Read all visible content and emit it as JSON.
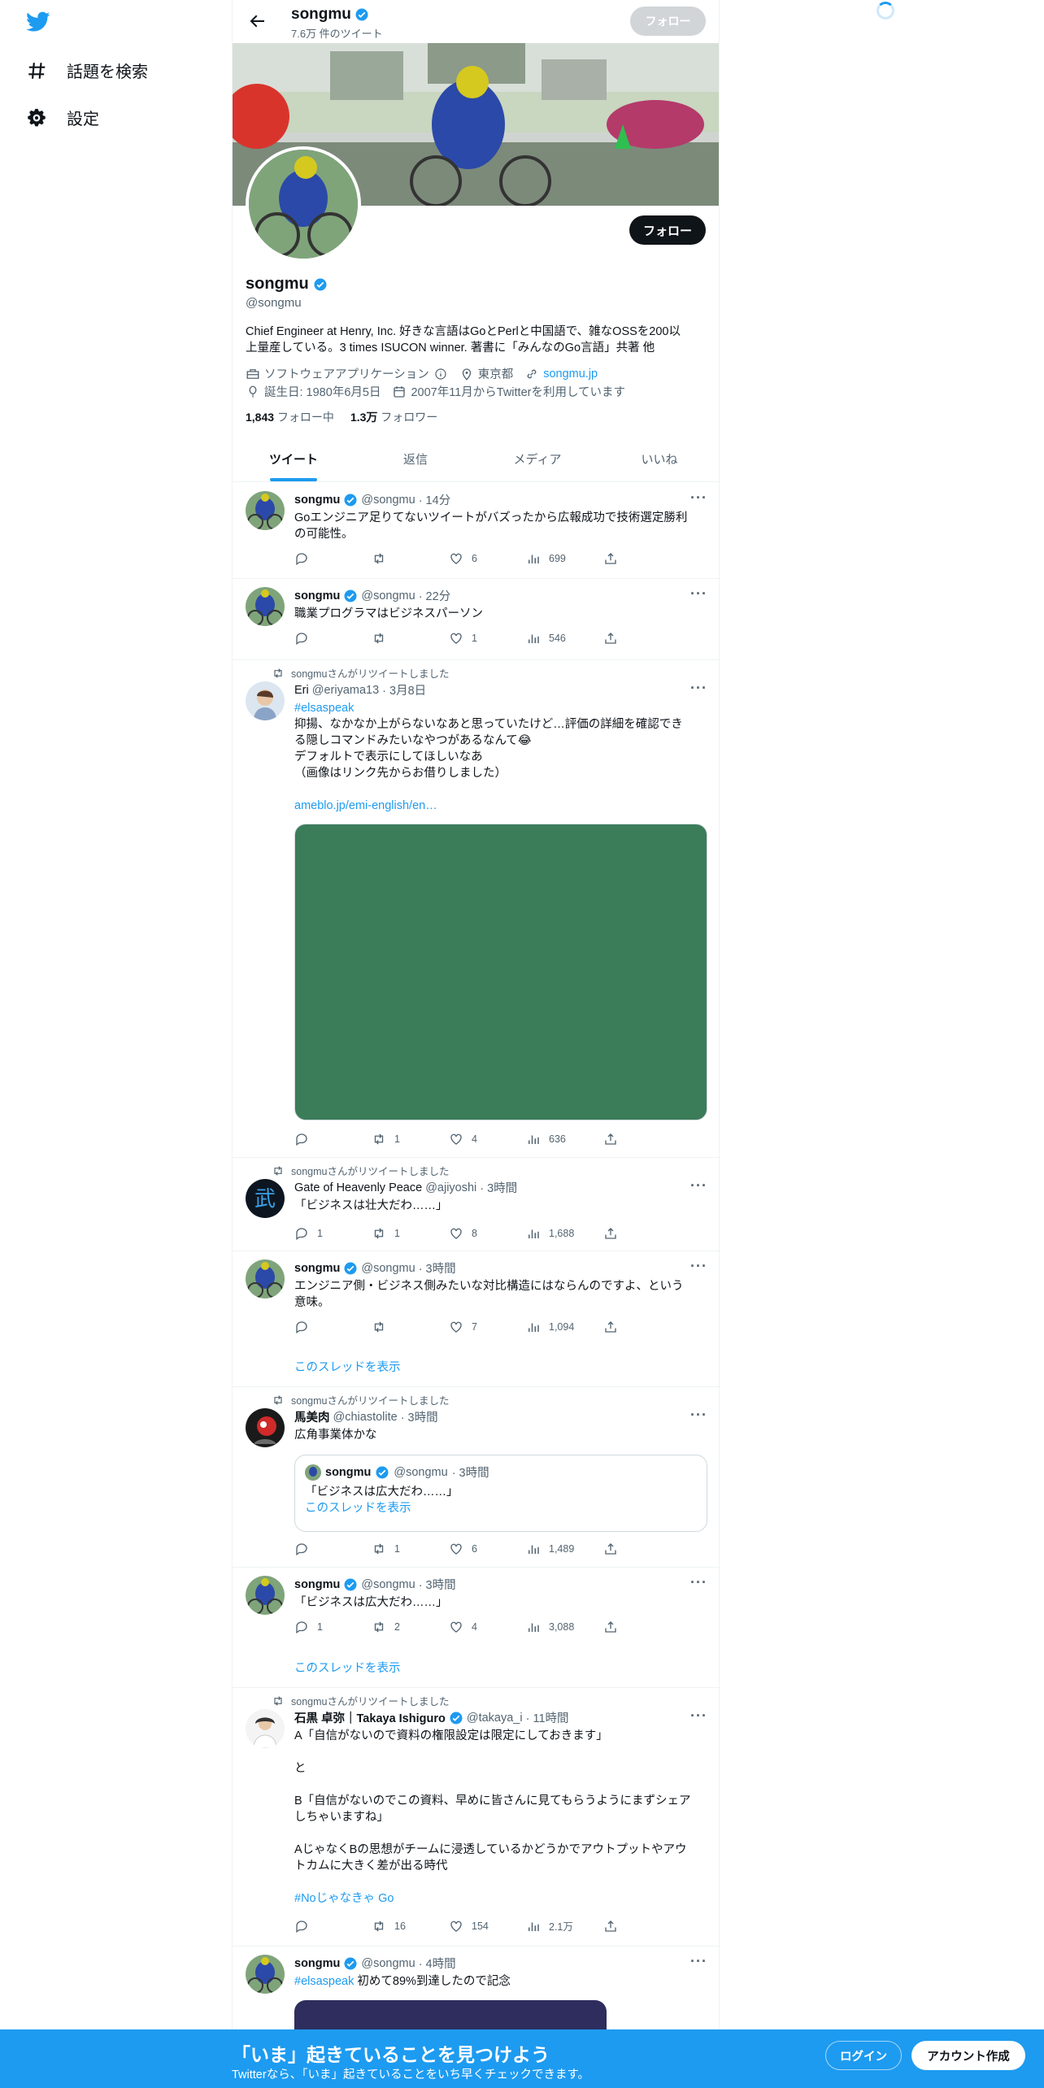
{
  "nav": {
    "explore_label": "話題を検索",
    "settings_label": "設定"
  },
  "header": {
    "name": "songmu",
    "tweet_count": "7.6万 件のツイート",
    "follow_label": "フォロー"
  },
  "profile": {
    "name": "songmu",
    "handle": "@songmu",
    "follow_label": "フォロー",
    "bio_line1": "Chief Engineer at Henry, Inc. 好きな言語はGoとPerlと中国語で、雑なOSSを200以",
    "bio_line2": "上量産している。3 times ISUCON winner. 著書に「みんなのGo言語」共著 他",
    "category": "ソフトウェアアプリケーション",
    "location": "東京都",
    "website": "songmu.jp",
    "birthday": "誕生日: 1980年6月5日",
    "joined": "2007年11月からTwitterを利用しています",
    "following_count": "1,843",
    "following_label": "フォロー中",
    "followers_count": "1.3万",
    "followers_label": "フォロワー"
  },
  "tabs": [
    "ツイート",
    "返信",
    "メディア",
    "いいね"
  ],
  "rt_suffix": "songmuさんがリツイートしました",
  "thread_label": "このスレッドを表示",
  "tweets": [
    {
      "name": "songmu",
      "handle": "@songmu",
      "time": "· 14分",
      "text": "Goエンジニア足りてないツイートがバズったから広報成功で技術選定勝利\nの可能性。",
      "reply": "",
      "rt": "",
      "like": "6",
      "views": "699"
    },
    {
      "name": "songmu",
      "handle": "@songmu",
      "time": "· 22分",
      "text": "職業プログラマはビジネスパーソン",
      "reply": "",
      "rt": "",
      "like": "1",
      "views": "546"
    },
    {
      "name": "Eri",
      "handle": "@eriyama13",
      "time": "· 3月8日",
      "hashtag": "#elsaspeak",
      "text": "抑揚、なかなか上がらないなあと思っていたけど…評価の詳細を確認でき\nる隠しコマンドみたいなやつがあるなんて😂\nデフォルトで表示にしてほしいなあ\n（画像はリンク先からお借りしました）",
      "link": "ameblo.jp/emi-english/en…",
      "reply": "",
      "rt": "1",
      "like": "4",
      "views": "636"
    },
    {
      "name": "Gate of Heavenly Peace",
      "handle": "@ajiyoshi",
      "time": "· 3時間",
      "text": "「ビジネスは壮大だわ……」",
      "reply": "1",
      "rt": "1",
      "like": "8",
      "views": "1,688"
    },
    {
      "name": "songmu",
      "handle": "@songmu",
      "time": "· 3時間",
      "text": "エンジニア側・ビジネス側みたいな対比構造にはならんのですよ、という\n意味。",
      "reply": "",
      "rt": "",
      "like": "7",
      "views": "1,094"
    },
    {
      "name": "馬美肉",
      "handle": "@chiastolite",
      "time": "· 3時間",
      "text": "広角事業体かな",
      "quote_name": "songmu",
      "quote_handle": "@songmu",
      "quote_time": "· 3時間",
      "quote_text": "「ビジネスは広大だわ……」",
      "reply": "",
      "rt": "1",
      "like": "6",
      "views": "1,489"
    },
    {
      "name": "songmu",
      "handle": "@songmu",
      "time": "· 3時間",
      "text": "「ビジネスは広大だわ……」",
      "reply": "1",
      "rt": "2",
      "like": "4",
      "views": "3,088"
    },
    {
      "name": "石黒 卓弥｜Takaya Ishiguro",
      "handle": "@takaya_i",
      "time": "· 11時間",
      "text": "A「自信がないので資料の権限設定は限定にしておきます」\n\nと\n\nB「自信がないのでこの資料、早めに皆さんに見てもらうようにまずシェア\nしちゃいますね」\n\nAじゃなくBの思想がチームに浸透しているかどうかでアウトプットやアウ\nトカムに大きく差が出る時代",
      "hashtag": "#Noじゃなきゃ Go",
      "reply": "",
      "rt": "16",
      "like": "154",
      "views": "2.1万"
    },
    {
      "name": "songmu",
      "handle": "@songmu",
      "time": "· 4時間",
      "hashtag": "#elsaspeak",
      "text": " 初めて89%到達したので記念"
    }
  ],
  "bottom": {
    "title": "「いま」起きていることを見つけよう",
    "subtitle": "Twitterなら、「いま」起きていることをいち早くチェックできます。",
    "login": "ログイン",
    "signup": "アカウント作成"
  },
  "colors": {
    "accent": "#1d9bf0",
    "text": "#0f1419",
    "muted": "#536471"
  }
}
